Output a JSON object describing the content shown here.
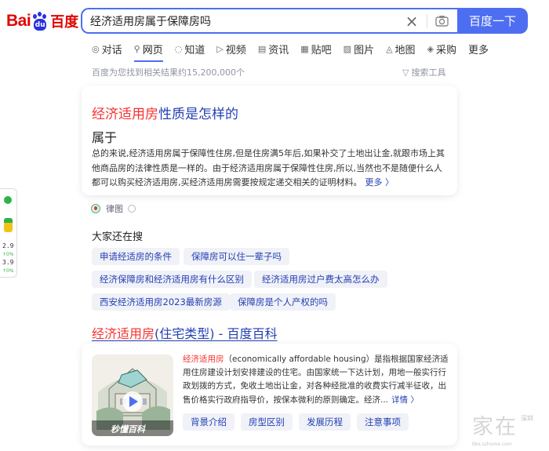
{
  "header": {
    "logo_left": "Bai",
    "logo_paw": "du",
    "logo_cn": "百度",
    "query": "经济适用房属于保障房吗",
    "search_button": "百度一下",
    "accent": "#4e6ef2",
    "brand": "#e10601"
  },
  "tabs": [
    {
      "label": "对话",
      "icon": "chat-icon"
    },
    {
      "label": "网页",
      "icon": "search-icon",
      "active": true
    },
    {
      "label": "知道",
      "icon": "question-icon"
    },
    {
      "label": "视频",
      "icon": "video-icon"
    },
    {
      "label": "资讯",
      "icon": "news-icon"
    },
    {
      "label": "贴吧",
      "icon": "tieba-icon"
    },
    {
      "label": "图片",
      "icon": "image-icon"
    },
    {
      "label": "地图",
      "icon": "map-icon"
    },
    {
      "label": "采购",
      "icon": "purchase-icon"
    },
    {
      "label": "更多",
      "icon": ""
    }
  ],
  "results_info": {
    "count_text": "百度为您找到相关结果约15,200,000个",
    "tools_label": "搜索工具"
  },
  "answer_card": {
    "title_highlight": "经济适用房",
    "title_rest": "性质是怎样的",
    "answer": "属于",
    "body": "总的来说,经济适用房属于保障性住房,但是住房满5年后,如果补交了土地出让金,就跟市场上其他商品房的法律性质是一样的。由于经济适用房属于保障性住房,所以,当然也不是随便什么人都可以购买经济适用房,买经济适用房需要按规定递交相关的证明材料。",
    "more": "更多 〉",
    "source": "律图"
  },
  "also_search": {
    "title": "大家还在搜",
    "items": [
      "申请经适房的条件",
      "保障房可以住一辈子吗",
      "经济保障房和经济适用房有什么区别",
      "经济适用房过户费太高怎么办",
      "西安经济适用房2023最新房源",
      "保障房是个人产权的吗"
    ]
  },
  "result2": {
    "title_highlight": "经济适用房",
    "title_rest": "(住宅类型) - 百度百科",
    "thumb_caption": "秒懂百科",
    "text_highlight": "经济适用房",
    "text_rest": "（economically affordable housing）是指根据国家经济适用住房建设计划安排建设的住宅。由国家统一下达计划，用地一般实行行政划拨的方式，免收土地出让金，对各种经批准的收费实行减半征收，出售价格实行政府指导价，按保本微利的原则确定。经济...",
    "more": "详情 〉",
    "chips": [
      "背景介绍",
      "房型区别",
      "发展历程",
      "注意事项"
    ]
  },
  "side_widget": {
    "v1": "2.9",
    "v1_sub": "↑0%",
    "v2": "3.9",
    "v2_sub": "↑0%"
  },
  "watermark": {
    "big": "家在",
    "small": "深圳",
    "url": "bbs.szhome.com"
  }
}
